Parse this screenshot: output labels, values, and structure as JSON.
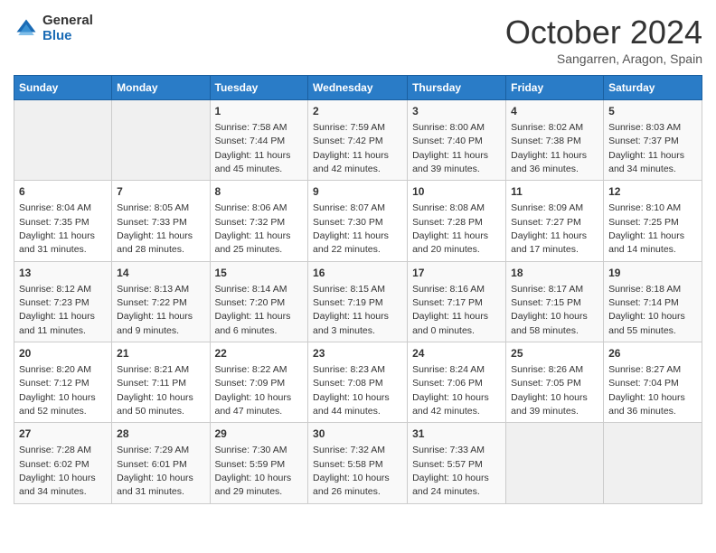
{
  "logo": {
    "general": "General",
    "blue": "Blue"
  },
  "header": {
    "month": "October 2024",
    "location": "Sangarren, Aragon, Spain"
  },
  "weekdays": [
    "Sunday",
    "Monday",
    "Tuesday",
    "Wednesday",
    "Thursday",
    "Friday",
    "Saturday"
  ],
  "weeks": [
    [
      {
        "day": "",
        "sunrise": "",
        "sunset": "",
        "daylight": ""
      },
      {
        "day": "",
        "sunrise": "",
        "sunset": "",
        "daylight": ""
      },
      {
        "day": "1",
        "sunrise": "Sunrise: 7:58 AM",
        "sunset": "Sunset: 7:44 PM",
        "daylight": "Daylight: 11 hours and 45 minutes."
      },
      {
        "day": "2",
        "sunrise": "Sunrise: 7:59 AM",
        "sunset": "Sunset: 7:42 PM",
        "daylight": "Daylight: 11 hours and 42 minutes."
      },
      {
        "day": "3",
        "sunrise": "Sunrise: 8:00 AM",
        "sunset": "Sunset: 7:40 PM",
        "daylight": "Daylight: 11 hours and 39 minutes."
      },
      {
        "day": "4",
        "sunrise": "Sunrise: 8:02 AM",
        "sunset": "Sunset: 7:38 PM",
        "daylight": "Daylight: 11 hours and 36 minutes."
      },
      {
        "day": "5",
        "sunrise": "Sunrise: 8:03 AM",
        "sunset": "Sunset: 7:37 PM",
        "daylight": "Daylight: 11 hours and 34 minutes."
      }
    ],
    [
      {
        "day": "6",
        "sunrise": "Sunrise: 8:04 AM",
        "sunset": "Sunset: 7:35 PM",
        "daylight": "Daylight: 11 hours and 31 minutes."
      },
      {
        "day": "7",
        "sunrise": "Sunrise: 8:05 AM",
        "sunset": "Sunset: 7:33 PM",
        "daylight": "Daylight: 11 hours and 28 minutes."
      },
      {
        "day": "8",
        "sunrise": "Sunrise: 8:06 AM",
        "sunset": "Sunset: 7:32 PM",
        "daylight": "Daylight: 11 hours and 25 minutes."
      },
      {
        "day": "9",
        "sunrise": "Sunrise: 8:07 AM",
        "sunset": "Sunset: 7:30 PM",
        "daylight": "Daylight: 11 hours and 22 minutes."
      },
      {
        "day": "10",
        "sunrise": "Sunrise: 8:08 AM",
        "sunset": "Sunset: 7:28 PM",
        "daylight": "Daylight: 11 hours and 20 minutes."
      },
      {
        "day": "11",
        "sunrise": "Sunrise: 8:09 AM",
        "sunset": "Sunset: 7:27 PM",
        "daylight": "Daylight: 11 hours and 17 minutes."
      },
      {
        "day": "12",
        "sunrise": "Sunrise: 8:10 AM",
        "sunset": "Sunset: 7:25 PM",
        "daylight": "Daylight: 11 hours and 14 minutes."
      }
    ],
    [
      {
        "day": "13",
        "sunrise": "Sunrise: 8:12 AM",
        "sunset": "Sunset: 7:23 PM",
        "daylight": "Daylight: 11 hours and 11 minutes."
      },
      {
        "day": "14",
        "sunrise": "Sunrise: 8:13 AM",
        "sunset": "Sunset: 7:22 PM",
        "daylight": "Daylight: 11 hours and 9 minutes."
      },
      {
        "day": "15",
        "sunrise": "Sunrise: 8:14 AM",
        "sunset": "Sunset: 7:20 PM",
        "daylight": "Daylight: 11 hours and 6 minutes."
      },
      {
        "day": "16",
        "sunrise": "Sunrise: 8:15 AM",
        "sunset": "Sunset: 7:19 PM",
        "daylight": "Daylight: 11 hours and 3 minutes."
      },
      {
        "day": "17",
        "sunrise": "Sunrise: 8:16 AM",
        "sunset": "Sunset: 7:17 PM",
        "daylight": "Daylight: 11 hours and 0 minutes."
      },
      {
        "day": "18",
        "sunrise": "Sunrise: 8:17 AM",
        "sunset": "Sunset: 7:15 PM",
        "daylight": "Daylight: 10 hours and 58 minutes."
      },
      {
        "day": "19",
        "sunrise": "Sunrise: 8:18 AM",
        "sunset": "Sunset: 7:14 PM",
        "daylight": "Daylight: 10 hours and 55 minutes."
      }
    ],
    [
      {
        "day": "20",
        "sunrise": "Sunrise: 8:20 AM",
        "sunset": "Sunset: 7:12 PM",
        "daylight": "Daylight: 10 hours and 52 minutes."
      },
      {
        "day": "21",
        "sunrise": "Sunrise: 8:21 AM",
        "sunset": "Sunset: 7:11 PM",
        "daylight": "Daylight: 10 hours and 50 minutes."
      },
      {
        "day": "22",
        "sunrise": "Sunrise: 8:22 AM",
        "sunset": "Sunset: 7:09 PM",
        "daylight": "Daylight: 10 hours and 47 minutes."
      },
      {
        "day": "23",
        "sunrise": "Sunrise: 8:23 AM",
        "sunset": "Sunset: 7:08 PM",
        "daylight": "Daylight: 10 hours and 44 minutes."
      },
      {
        "day": "24",
        "sunrise": "Sunrise: 8:24 AM",
        "sunset": "Sunset: 7:06 PM",
        "daylight": "Daylight: 10 hours and 42 minutes."
      },
      {
        "day": "25",
        "sunrise": "Sunrise: 8:26 AM",
        "sunset": "Sunset: 7:05 PM",
        "daylight": "Daylight: 10 hours and 39 minutes."
      },
      {
        "day": "26",
        "sunrise": "Sunrise: 8:27 AM",
        "sunset": "Sunset: 7:04 PM",
        "daylight": "Daylight: 10 hours and 36 minutes."
      }
    ],
    [
      {
        "day": "27",
        "sunrise": "Sunrise: 7:28 AM",
        "sunset": "Sunset: 6:02 PM",
        "daylight": "Daylight: 10 hours and 34 minutes."
      },
      {
        "day": "28",
        "sunrise": "Sunrise: 7:29 AM",
        "sunset": "Sunset: 6:01 PM",
        "daylight": "Daylight: 10 hours and 31 minutes."
      },
      {
        "day": "29",
        "sunrise": "Sunrise: 7:30 AM",
        "sunset": "Sunset: 5:59 PM",
        "daylight": "Daylight: 10 hours and 29 minutes."
      },
      {
        "day": "30",
        "sunrise": "Sunrise: 7:32 AM",
        "sunset": "Sunset: 5:58 PM",
        "daylight": "Daylight: 10 hours and 26 minutes."
      },
      {
        "day": "31",
        "sunrise": "Sunrise: 7:33 AM",
        "sunset": "Sunset: 5:57 PM",
        "daylight": "Daylight: 10 hours and 24 minutes."
      },
      {
        "day": "",
        "sunrise": "",
        "sunset": "",
        "daylight": ""
      },
      {
        "day": "",
        "sunrise": "",
        "sunset": "",
        "daylight": ""
      }
    ]
  ]
}
